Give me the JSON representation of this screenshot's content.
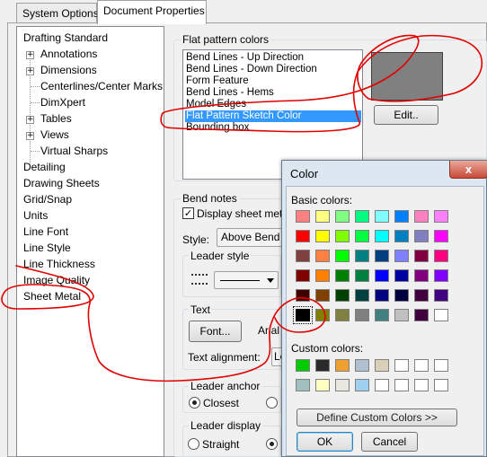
{
  "tabs": {
    "system_options": "System Options",
    "document_properties": "Document Properties"
  },
  "tree": {
    "items": [
      "Drafting Standard",
      "Annotations",
      "Dimensions",
      "Centerlines/Center Marks",
      "DimXpert",
      "Tables",
      "Views",
      "Virtual Sharps",
      "Detailing",
      "Drawing Sheets",
      "Grid/Snap",
      "Units",
      "Line Font",
      "Line Style",
      "Line Thickness",
      "Image Quality",
      "Sheet Metal"
    ]
  },
  "flat_pattern": {
    "label": "Flat pattern colors",
    "items": [
      "Bend Lines - Up Direction",
      "Bend Lines - Down Direction",
      "Form Feature",
      "Bend Lines - Hems",
      "Model Edges",
      "Flat Pattern Sketch Color",
      "Bounding box"
    ],
    "selected_index": 5,
    "swatch_color": "#808080",
    "edit_label": "Edit.."
  },
  "bend_notes": {
    "label": "Bend notes",
    "display_label": "Display sheet meta",
    "display_checked": true,
    "style_label": "Style:",
    "style_value": "Above Bend L",
    "leader_style_label": "Leader style"
  },
  "text_group": {
    "label": "Text",
    "font_button": "Font...",
    "font_value": "Arial",
    "alignment_label": "Text alignment:",
    "alignment_value": "Le"
  },
  "leader_anchor": {
    "label": "Leader anchor",
    "closest": "Closest"
  },
  "leader_display": {
    "label": "Leader display",
    "straight": "Straight"
  },
  "color_dialog": {
    "title": "Color",
    "close": "x",
    "basic_label": "Basic colors:",
    "basic_colors": [
      [
        "#ff8080",
        "#ffff80",
        "#80ff80",
        "#00ff80",
        "#80ffff",
        "#0080ff",
        "#ff80c0",
        "#ff80ff"
      ],
      [
        "#ff0000",
        "#ffff00",
        "#80ff00",
        "#00ff40",
        "#00ffff",
        "#0080c0",
        "#8080c0",
        "#ff00ff"
      ],
      [
        "#804040",
        "#ff8040",
        "#00ff00",
        "#008080",
        "#004080",
        "#8080ff",
        "#800040",
        "#ff0080"
      ],
      [
        "#800000",
        "#ff8000",
        "#008000",
        "#008040",
        "#0000ff",
        "#0000a0",
        "#800080",
        "#8000ff"
      ],
      [
        "#400000",
        "#804000",
        "#004000",
        "#004040",
        "#000080",
        "#000040",
        "#400040",
        "#400080"
      ],
      [
        "#000000",
        "#808000",
        "#808040",
        "#808080",
        "#408080",
        "#c0c0c0",
        "#400040",
        "#ffffff"
      ]
    ],
    "selected_basic": [
      5,
      0
    ],
    "custom_label": "Custom colors:",
    "custom_colors": [
      [
        "#00cc00",
        "#2a2a2a",
        "#f0a030",
        "#b0c0d0",
        "#d8d0b8",
        "#ffffff",
        "#ffffff",
        "#ffffff"
      ],
      [
        "#a0c0c0",
        "#ffffc0",
        "#e8e8e0",
        "#a0d0f0",
        "#ffffff",
        "#ffffff",
        "#ffffff",
        "#ffffff"
      ]
    ],
    "define_label": "Define Custom Colors >>",
    "ok_label": "OK",
    "cancel_label": "Cancel"
  },
  "annotation_color": "#e00000"
}
